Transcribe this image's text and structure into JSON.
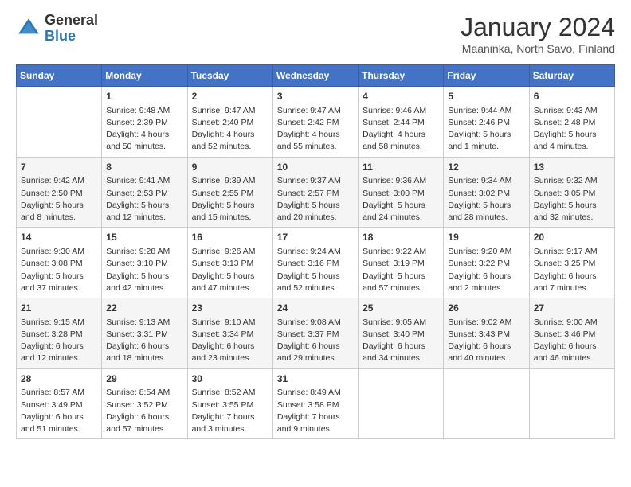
{
  "logo": {
    "general": "General",
    "blue": "Blue"
  },
  "title": "January 2024",
  "subtitle": "Maaninka, North Savo, Finland",
  "days_of_week": [
    "Sunday",
    "Monday",
    "Tuesday",
    "Wednesday",
    "Thursday",
    "Friday",
    "Saturday"
  ],
  "weeks": [
    [
      {
        "day": "",
        "info": ""
      },
      {
        "day": "1",
        "info": "Sunrise: 9:48 AM\nSunset: 2:39 PM\nDaylight: 4 hours\nand 50 minutes."
      },
      {
        "day": "2",
        "info": "Sunrise: 9:47 AM\nSunset: 2:40 PM\nDaylight: 4 hours\nand 52 minutes."
      },
      {
        "day": "3",
        "info": "Sunrise: 9:47 AM\nSunset: 2:42 PM\nDaylight: 4 hours\nand 55 minutes."
      },
      {
        "day": "4",
        "info": "Sunrise: 9:46 AM\nSunset: 2:44 PM\nDaylight: 4 hours\nand 58 minutes."
      },
      {
        "day": "5",
        "info": "Sunrise: 9:44 AM\nSunset: 2:46 PM\nDaylight: 5 hours\nand 1 minute."
      },
      {
        "day": "6",
        "info": "Sunrise: 9:43 AM\nSunset: 2:48 PM\nDaylight: 5 hours\nand 4 minutes."
      }
    ],
    [
      {
        "day": "7",
        "info": "Sunrise: 9:42 AM\nSunset: 2:50 PM\nDaylight: 5 hours\nand 8 minutes."
      },
      {
        "day": "8",
        "info": "Sunrise: 9:41 AM\nSunset: 2:53 PM\nDaylight: 5 hours\nand 12 minutes."
      },
      {
        "day": "9",
        "info": "Sunrise: 9:39 AM\nSunset: 2:55 PM\nDaylight: 5 hours\nand 15 minutes."
      },
      {
        "day": "10",
        "info": "Sunrise: 9:37 AM\nSunset: 2:57 PM\nDaylight: 5 hours\nand 20 minutes."
      },
      {
        "day": "11",
        "info": "Sunrise: 9:36 AM\nSunset: 3:00 PM\nDaylight: 5 hours\nand 24 minutes."
      },
      {
        "day": "12",
        "info": "Sunrise: 9:34 AM\nSunset: 3:02 PM\nDaylight: 5 hours\nand 28 minutes."
      },
      {
        "day": "13",
        "info": "Sunrise: 9:32 AM\nSunset: 3:05 PM\nDaylight: 5 hours\nand 32 minutes."
      }
    ],
    [
      {
        "day": "14",
        "info": "Sunrise: 9:30 AM\nSunset: 3:08 PM\nDaylight: 5 hours\nand 37 minutes."
      },
      {
        "day": "15",
        "info": "Sunrise: 9:28 AM\nSunset: 3:10 PM\nDaylight: 5 hours\nand 42 minutes."
      },
      {
        "day": "16",
        "info": "Sunrise: 9:26 AM\nSunset: 3:13 PM\nDaylight: 5 hours\nand 47 minutes."
      },
      {
        "day": "17",
        "info": "Sunrise: 9:24 AM\nSunset: 3:16 PM\nDaylight: 5 hours\nand 52 minutes."
      },
      {
        "day": "18",
        "info": "Sunrise: 9:22 AM\nSunset: 3:19 PM\nDaylight: 5 hours\nand 57 minutes."
      },
      {
        "day": "19",
        "info": "Sunrise: 9:20 AM\nSunset: 3:22 PM\nDaylight: 6 hours\nand 2 minutes."
      },
      {
        "day": "20",
        "info": "Sunrise: 9:17 AM\nSunset: 3:25 PM\nDaylight: 6 hours\nand 7 minutes."
      }
    ],
    [
      {
        "day": "21",
        "info": "Sunrise: 9:15 AM\nSunset: 3:28 PM\nDaylight: 6 hours\nand 12 minutes."
      },
      {
        "day": "22",
        "info": "Sunrise: 9:13 AM\nSunset: 3:31 PM\nDaylight: 6 hours\nand 18 minutes."
      },
      {
        "day": "23",
        "info": "Sunrise: 9:10 AM\nSunset: 3:34 PM\nDaylight: 6 hours\nand 23 minutes."
      },
      {
        "day": "24",
        "info": "Sunrise: 9:08 AM\nSunset: 3:37 PM\nDaylight: 6 hours\nand 29 minutes."
      },
      {
        "day": "25",
        "info": "Sunrise: 9:05 AM\nSunset: 3:40 PM\nDaylight: 6 hours\nand 34 minutes."
      },
      {
        "day": "26",
        "info": "Sunrise: 9:02 AM\nSunset: 3:43 PM\nDaylight: 6 hours\nand 40 minutes."
      },
      {
        "day": "27",
        "info": "Sunrise: 9:00 AM\nSunset: 3:46 PM\nDaylight: 6 hours\nand 46 minutes."
      }
    ],
    [
      {
        "day": "28",
        "info": "Sunrise: 8:57 AM\nSunset: 3:49 PM\nDaylight: 6 hours\nand 51 minutes."
      },
      {
        "day": "29",
        "info": "Sunrise: 8:54 AM\nSunset: 3:52 PM\nDaylight: 6 hours\nand 57 minutes."
      },
      {
        "day": "30",
        "info": "Sunrise: 8:52 AM\nSunset: 3:55 PM\nDaylight: 7 hours\nand 3 minutes."
      },
      {
        "day": "31",
        "info": "Sunrise: 8:49 AM\nSunset: 3:58 PM\nDaylight: 7 hours\nand 9 minutes."
      },
      {
        "day": "",
        "info": ""
      },
      {
        "day": "",
        "info": ""
      },
      {
        "day": "",
        "info": ""
      }
    ]
  ]
}
